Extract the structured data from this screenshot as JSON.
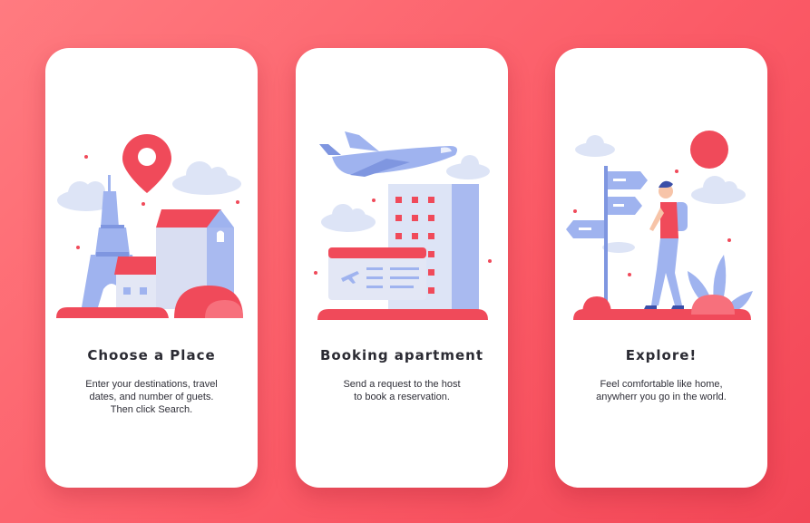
{
  "cards": [
    {
      "title": "Choose a Place",
      "description": [
        "Enter your destinations, travel",
        "dates, and number of guets.",
        "Then click Search."
      ],
      "illustration": "map-pin-eiffel-tower-illustration"
    },
    {
      "title": "Booking apartment",
      "description": [
        "Send a request to the host",
        "to book a reservation."
      ],
      "illustration": "airplane-hotel-ticket-illustration"
    },
    {
      "title": "Explore!",
      "description": [
        "Feel comfortable like home,",
        "anywherr you go in the world."
      ],
      "illustration": "traveler-signpost-illustration"
    }
  ],
  "colors": {
    "background": "#fb5b67",
    "card": "#ffffff",
    "accent_red": "#f04a5a",
    "illustration_blue": "#9fb3ef",
    "cloud": "#dde4f6",
    "text": "#2b2b33"
  }
}
